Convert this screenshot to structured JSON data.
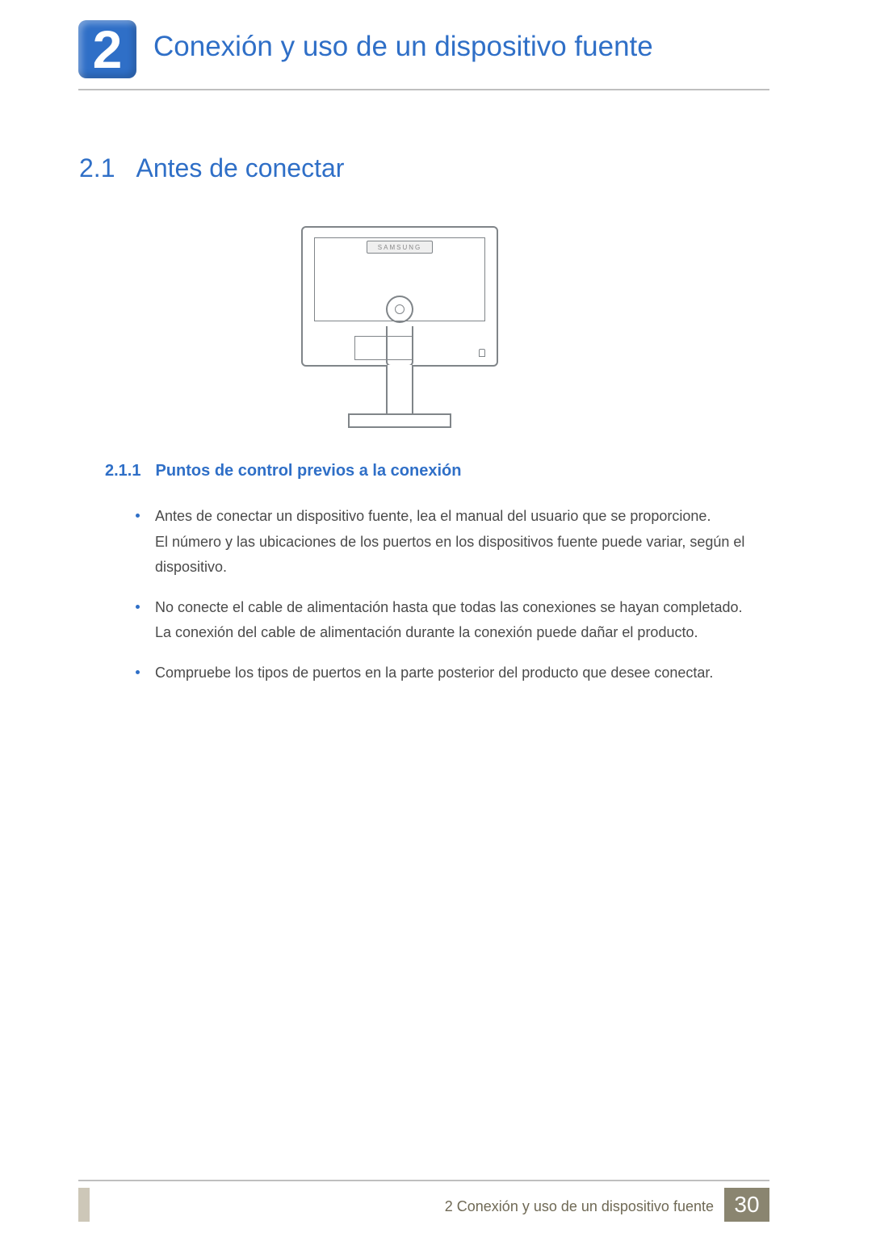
{
  "chapter": {
    "number": "2",
    "title": "Conexión y uso de un dispositivo fuente"
  },
  "section": {
    "number": "2.1",
    "title": "Antes de conectar"
  },
  "figure": {
    "brand": "SAMSUNG"
  },
  "subsection": {
    "number": "2.1.1",
    "title": "Puntos de control previos a la conexión"
  },
  "bullets": [
    {
      "lines": [
        "Antes de conectar un dispositivo fuente, lea el manual del usuario que se proporcione.",
        "El número y las ubicaciones de los puertos en los dispositivos fuente puede variar, según el dispositivo."
      ]
    },
    {
      "lines": [
        "No conecte el cable de alimentación hasta que todas las conexiones se hayan completado.",
        "La conexión del cable de alimentación durante la conexión puede dañar el producto."
      ]
    },
    {
      "lines": [
        "Compruebe los tipos de puertos en la parte posterior del producto que desee conectar."
      ]
    }
  ],
  "footer": {
    "text": "2 Conexión y uso de un dispositivo fuente",
    "page": "30"
  }
}
